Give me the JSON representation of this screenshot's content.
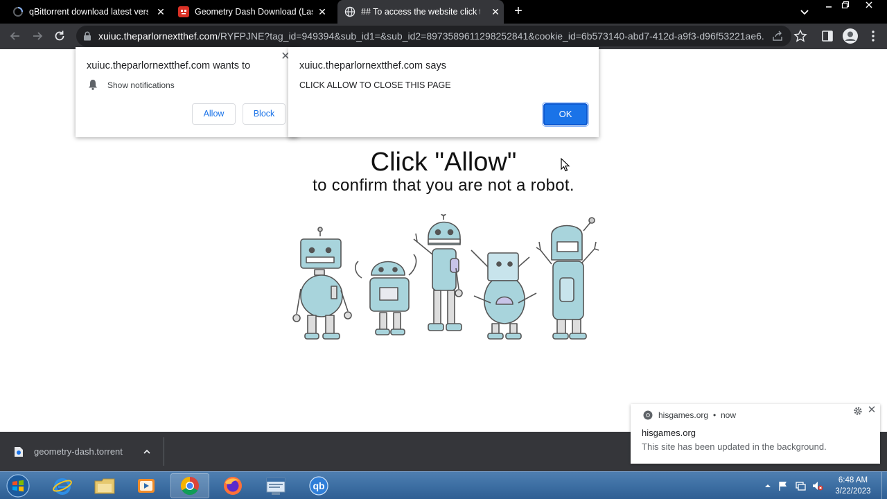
{
  "tabs": [
    {
      "title": "qBittorrent download latest versi",
      "active": false
    },
    {
      "title": "Geometry Dash Download (Last V",
      "active": false
    },
    {
      "title": "## To access the website click th",
      "active": true
    }
  ],
  "address_bar": {
    "host": "xuiuc.theparlornextthef.com",
    "path": "/RYFPJNE?tag_id=949394&sub_id1=&sub_id2=8973589611298252841&cookie_id=6b573140-abd7-412d-a9f3-d96f53221ae6..."
  },
  "permission_prompt": {
    "title": "xuiuc.theparlornextthef.com wants to",
    "item": "Show notifications",
    "allow_label": "Allow",
    "block_label": "Block"
  },
  "alert_dialog": {
    "title": "xuiuc.theparlornextthef.com says",
    "message": "CLICK ALLOW TO CLOSE THIS PAGE",
    "ok_label": "OK"
  },
  "page": {
    "headline": "Click \"Allow\"",
    "subline": "to confirm that you are not a robot."
  },
  "download_shelf": {
    "file_name": "geometry-dash.torrent"
  },
  "notification": {
    "source": "hisgames.org",
    "separator": "•",
    "time": "now",
    "title": "hisgames.org",
    "body": "This site has been updated in the background."
  },
  "taskbar": {
    "apps": [
      "start-orb",
      "internet-explorer",
      "file-explorer",
      "media-player",
      "chrome",
      "firefox",
      "app-window",
      "qbittorrent"
    ],
    "qb_label": "qb",
    "time": "6:48 AM",
    "date": "3/22/2023"
  },
  "colors": {
    "accent": "#1a73e8",
    "tabstrip": "#000000",
    "toolbar": "#35363a",
    "taskbar": "#3d6fa3"
  }
}
